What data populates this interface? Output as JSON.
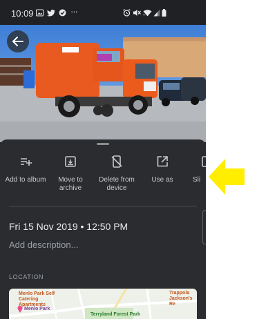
{
  "statusbar": {
    "time": "10:09",
    "more_glyph": "···",
    "left_icons": [
      "image-icon",
      "twitter-icon",
      "vpn-icon"
    ],
    "right_icons": [
      "alarm-icon",
      "mute-icon",
      "wifi-icon",
      "signal-icon",
      "battery-icon"
    ]
  },
  "photo": {
    "subject": "orange street sweeper truck in a car park"
  },
  "actions": [
    {
      "label": "Add to album",
      "icon": "add-to-playlist-icon"
    },
    {
      "label": "Move to archive",
      "icon": "archive-icon"
    },
    {
      "label": "Delete from device",
      "icon": "delete-from-device-icon"
    },
    {
      "label": "Use as",
      "icon": "open-external-icon"
    },
    {
      "label": "Sli",
      "icon": "slideshow-icon"
    }
  ],
  "details": {
    "datetime": "Fri 15 Nov 2019  •  12:50 PM",
    "description_placeholder": "Add description..."
  },
  "location": {
    "section_label": "LOCATION",
    "map_labels": {
      "menlo_self_catering": "Menlo Park Self Catering Apartments",
      "menlo_park": "Menlo Park",
      "terryland": "Terryland Forest Park",
      "trappola": "Trappola Jackson's Re"
    }
  },
  "colors": {
    "accent_arrow": "#ffee00",
    "sheet_bg": "#2b2c2f",
    "screen_bg": "#202124"
  }
}
